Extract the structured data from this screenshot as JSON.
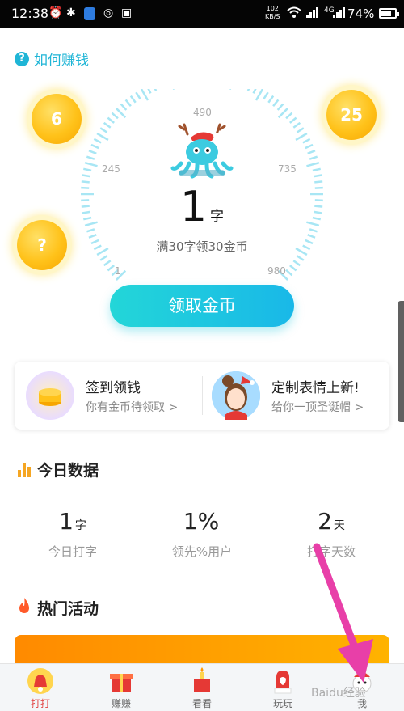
{
  "status_bar": {
    "time": "12:38",
    "net_speed_value": "102",
    "net_speed_unit": "KB/S",
    "battery": "74%"
  },
  "header": {
    "how_to_earn": "如何赚钱"
  },
  "coins": {
    "left_top": "6",
    "left_bottom": "?",
    "right_top": "25"
  },
  "gauge": {
    "ticks": [
      "1",
      "245",
      "490",
      "735",
      "980"
    ],
    "count": "1",
    "count_unit": "字",
    "hint": "满30字领30金币",
    "claim_button": "领取金币"
  },
  "cards": {
    "signin_title": "签到领钱",
    "signin_sub": "你有金币待领取 >",
    "emoji_title": "定制表情上新!",
    "emoji_sub": "给你一顶圣诞帽 >"
  },
  "today": {
    "title": "今日数据",
    "stats": [
      {
        "value": "1",
        "unit": "字",
        "label": "今日打字"
      },
      {
        "value": "1%",
        "unit": "",
        "label": "领先%用户"
      },
      {
        "value": "2",
        "unit": "天",
        "label": "打字天数"
      }
    ]
  },
  "hot": {
    "title": "热门活动"
  },
  "nav": {
    "items": [
      {
        "label": "打打"
      },
      {
        "label": "赚赚"
      },
      {
        "label": "看看"
      },
      {
        "label": "玩玩"
      },
      {
        "label": "我"
      }
    ]
  },
  "watermark": "Baidu经验",
  "colors": {
    "accent": "#1fb5d6",
    "coin": "#ffc21a",
    "arrow": "#e83fa8",
    "banner": "#ff9a00"
  }
}
